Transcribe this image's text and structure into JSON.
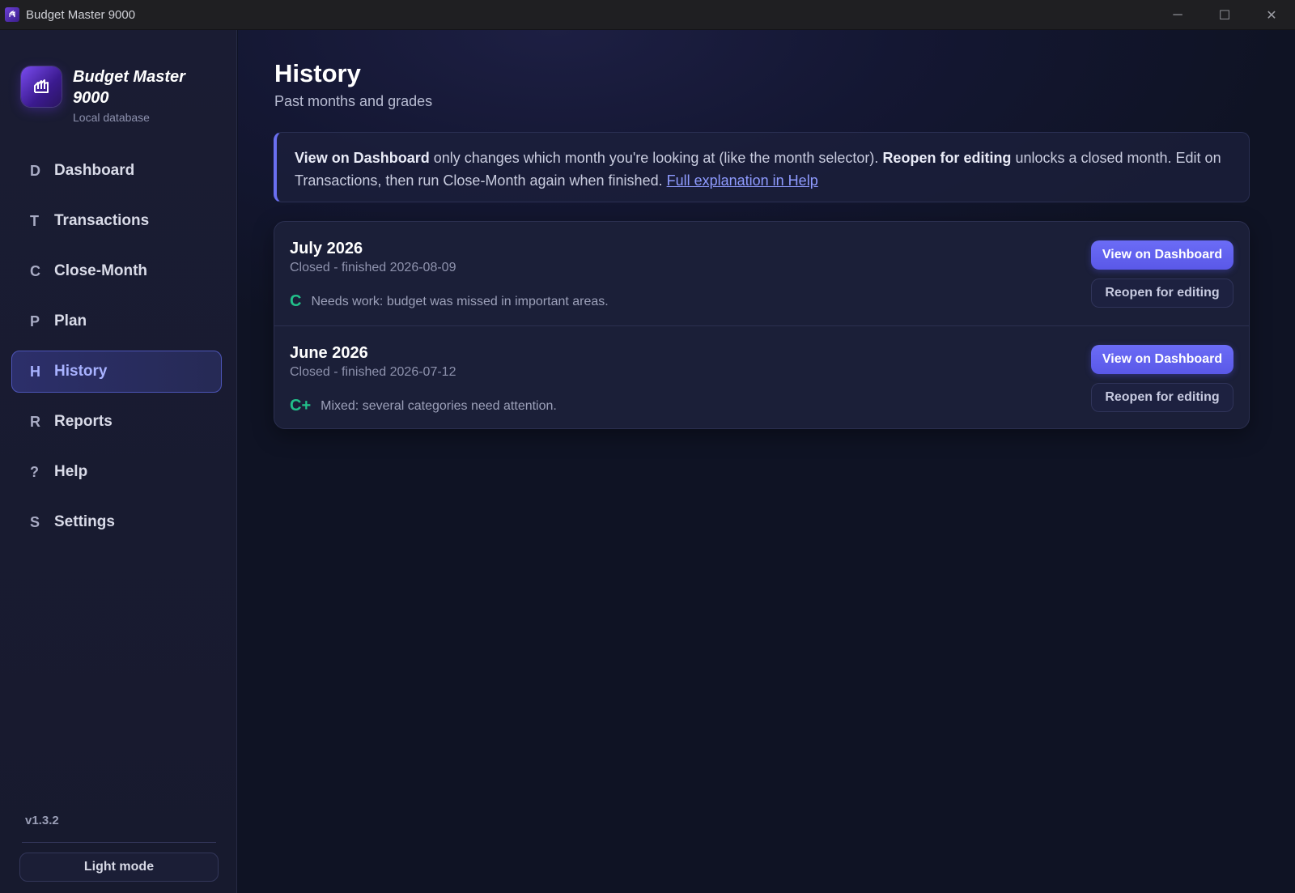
{
  "window": {
    "title": "Budget Master 9000",
    "controls": {
      "minimize": "─",
      "maximize": "☐",
      "close": "✕"
    }
  },
  "brand": {
    "name": "Budget Master 9000",
    "subtitle": "Local database"
  },
  "nav": [
    {
      "letter": "D",
      "label": "Dashboard",
      "active": false
    },
    {
      "letter": "T",
      "label": "Transactions",
      "active": false
    },
    {
      "letter": "C",
      "label": "Close-Month",
      "active": false
    },
    {
      "letter": "P",
      "label": "Plan",
      "active": false
    },
    {
      "letter": "H",
      "label": "History",
      "active": true
    },
    {
      "letter": "R",
      "label": "Reports",
      "active": false
    },
    {
      "letter": "?",
      "label": "Help",
      "active": false
    },
    {
      "letter": "S",
      "label": "Settings",
      "active": false
    }
  ],
  "sidebar_footer": {
    "version": "v1.3.2",
    "theme_button": "Light mode"
  },
  "page": {
    "title": "History",
    "subtitle": "Past months and grades"
  },
  "info": {
    "bold1": "View on Dashboard",
    "text1": " only changes which month you're looking at (like the month selector). ",
    "bold2": "Reopen for editing",
    "text2": " unlocks a closed month. Edit on Transactions, then run Close-Month again when finished. ",
    "link": "Full explanation in Help"
  },
  "months": [
    {
      "name": "July 2026",
      "status": "Closed - finished 2026-08-09",
      "grade": "C",
      "note": "Needs work: budget was missed in important areas.",
      "view_label": "View on Dashboard",
      "reopen_label": "Reopen for editing"
    },
    {
      "name": "June 2026",
      "status": "Closed - finished 2026-07-12",
      "grade": "C+",
      "note": "Mixed: several categories need attention.",
      "view_label": "View on Dashboard",
      "reopen_label": "Reopen for editing"
    }
  ],
  "colors": {
    "accent": "#5a58e8",
    "grade": "#22c08a",
    "link": "#8f9bff"
  }
}
